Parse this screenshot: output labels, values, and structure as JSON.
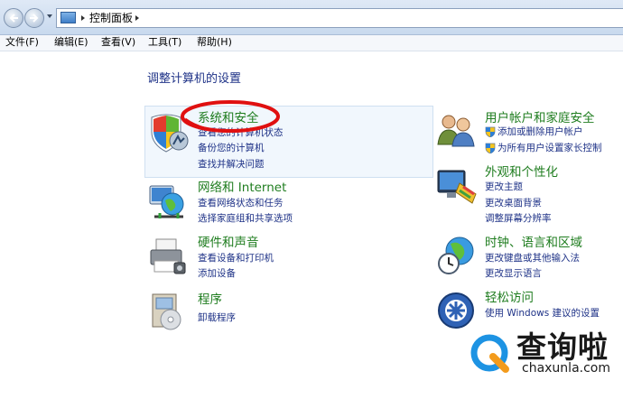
{
  "address_bar": {
    "path": "控制面板"
  },
  "menu": [
    {
      "label": "文件(F)"
    },
    {
      "label": "编辑(E)"
    },
    {
      "label": "查看(V)"
    },
    {
      "label": "工具(T)"
    },
    {
      "label": "帮助(H)"
    }
  ],
  "heading": "调整计算机的设置",
  "categories": {
    "system_security": {
      "title": "系统和安全",
      "links": [
        "查看您的计算机状态",
        "备份您的计算机",
        "查找并解决问题"
      ],
      "icon": "shield-icon"
    },
    "network": {
      "title": "网络和 Internet",
      "links": [
        "查看网络状态和任务",
        "选择家庭组和共享选项"
      ],
      "icon": "network-globe-icon"
    },
    "hardware": {
      "title": "硬件和声音",
      "links": [
        "查看设备和打印机",
        "添加设备"
      ],
      "icon": "printer-icon"
    },
    "programs": {
      "title": "程序",
      "links": [
        "卸载程序"
      ],
      "icon": "programs-box-icon"
    },
    "user_accounts": {
      "title": "用户帐户和家庭安全",
      "links": [
        "添加或删除用户帐户",
        "为所有用户设置家长控制"
      ],
      "icon": "users-icon"
    },
    "appearance": {
      "title": "外观和个性化",
      "links": [
        "更改主题",
        "更改桌面背景",
        "调整屏幕分辨率"
      ],
      "icon": "appearance-icon"
    },
    "clock_region": {
      "title": "时钟、语言和区域",
      "links": [
        "更改键盘或其他输入法",
        "更改显示语言"
      ],
      "icon": "clock-globe-icon"
    },
    "ease_of_access": {
      "title": "轻松访问",
      "links": [
        "使用 Windows 建议的设置"
      ],
      "icon": "accessibility-icon"
    }
  },
  "watermark": {
    "brand": "查询啦",
    "url": "chaxunla.com"
  },
  "colors": {
    "category_title": "#1f7d1f",
    "link": "#1e3287",
    "highlight_oval": "#e01010"
  }
}
